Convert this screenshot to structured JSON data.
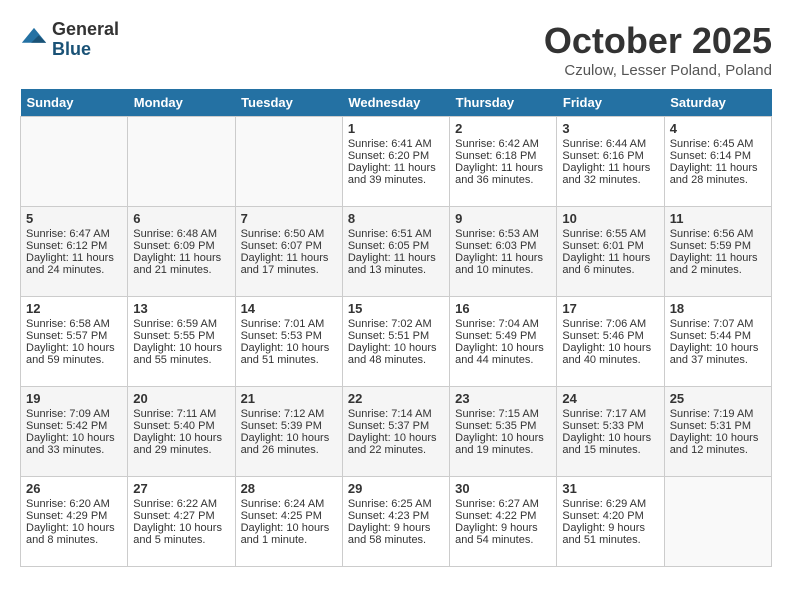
{
  "header": {
    "logo_general": "General",
    "logo_blue": "Blue",
    "month_title": "October 2025",
    "location": "Czulow, Lesser Poland, Poland"
  },
  "days_of_week": [
    "Sunday",
    "Monday",
    "Tuesday",
    "Wednesday",
    "Thursday",
    "Friday",
    "Saturday"
  ],
  "weeks": [
    [
      {
        "day": "",
        "content": ""
      },
      {
        "day": "",
        "content": ""
      },
      {
        "day": "",
        "content": ""
      },
      {
        "day": "1",
        "content": "Sunrise: 6:41 AM\nSunset: 6:20 PM\nDaylight: 11 hours\nand 39 minutes."
      },
      {
        "day": "2",
        "content": "Sunrise: 6:42 AM\nSunset: 6:18 PM\nDaylight: 11 hours\nand 36 minutes."
      },
      {
        "day": "3",
        "content": "Sunrise: 6:44 AM\nSunset: 6:16 PM\nDaylight: 11 hours\nand 32 minutes."
      },
      {
        "day": "4",
        "content": "Sunrise: 6:45 AM\nSunset: 6:14 PM\nDaylight: 11 hours\nand 28 minutes."
      }
    ],
    [
      {
        "day": "5",
        "content": "Sunrise: 6:47 AM\nSunset: 6:12 PM\nDaylight: 11 hours\nand 24 minutes."
      },
      {
        "day": "6",
        "content": "Sunrise: 6:48 AM\nSunset: 6:09 PM\nDaylight: 11 hours\nand 21 minutes."
      },
      {
        "day": "7",
        "content": "Sunrise: 6:50 AM\nSunset: 6:07 PM\nDaylight: 11 hours\nand 17 minutes."
      },
      {
        "day": "8",
        "content": "Sunrise: 6:51 AM\nSunset: 6:05 PM\nDaylight: 11 hours\nand 13 minutes."
      },
      {
        "day": "9",
        "content": "Sunrise: 6:53 AM\nSunset: 6:03 PM\nDaylight: 11 hours\nand 10 minutes."
      },
      {
        "day": "10",
        "content": "Sunrise: 6:55 AM\nSunset: 6:01 PM\nDaylight: 11 hours\nand 6 minutes."
      },
      {
        "day": "11",
        "content": "Sunrise: 6:56 AM\nSunset: 5:59 PM\nDaylight: 11 hours\nand 2 minutes."
      }
    ],
    [
      {
        "day": "12",
        "content": "Sunrise: 6:58 AM\nSunset: 5:57 PM\nDaylight: 10 hours\nand 59 minutes."
      },
      {
        "day": "13",
        "content": "Sunrise: 6:59 AM\nSunset: 5:55 PM\nDaylight: 10 hours\nand 55 minutes."
      },
      {
        "day": "14",
        "content": "Sunrise: 7:01 AM\nSunset: 5:53 PM\nDaylight: 10 hours\nand 51 minutes."
      },
      {
        "day": "15",
        "content": "Sunrise: 7:02 AM\nSunset: 5:51 PM\nDaylight: 10 hours\nand 48 minutes."
      },
      {
        "day": "16",
        "content": "Sunrise: 7:04 AM\nSunset: 5:49 PM\nDaylight: 10 hours\nand 44 minutes."
      },
      {
        "day": "17",
        "content": "Sunrise: 7:06 AM\nSunset: 5:46 PM\nDaylight: 10 hours\nand 40 minutes."
      },
      {
        "day": "18",
        "content": "Sunrise: 7:07 AM\nSunset: 5:44 PM\nDaylight: 10 hours\nand 37 minutes."
      }
    ],
    [
      {
        "day": "19",
        "content": "Sunrise: 7:09 AM\nSunset: 5:42 PM\nDaylight: 10 hours\nand 33 minutes."
      },
      {
        "day": "20",
        "content": "Sunrise: 7:11 AM\nSunset: 5:40 PM\nDaylight: 10 hours\nand 29 minutes."
      },
      {
        "day": "21",
        "content": "Sunrise: 7:12 AM\nSunset: 5:39 PM\nDaylight: 10 hours\nand 26 minutes."
      },
      {
        "day": "22",
        "content": "Sunrise: 7:14 AM\nSunset: 5:37 PM\nDaylight: 10 hours\nand 22 minutes."
      },
      {
        "day": "23",
        "content": "Sunrise: 7:15 AM\nSunset: 5:35 PM\nDaylight: 10 hours\nand 19 minutes."
      },
      {
        "day": "24",
        "content": "Sunrise: 7:17 AM\nSunset: 5:33 PM\nDaylight: 10 hours\nand 15 minutes."
      },
      {
        "day": "25",
        "content": "Sunrise: 7:19 AM\nSunset: 5:31 PM\nDaylight: 10 hours\nand 12 minutes."
      }
    ],
    [
      {
        "day": "26",
        "content": "Sunrise: 6:20 AM\nSunset: 4:29 PM\nDaylight: 10 hours\nand 8 minutes."
      },
      {
        "day": "27",
        "content": "Sunrise: 6:22 AM\nSunset: 4:27 PM\nDaylight: 10 hours\nand 5 minutes."
      },
      {
        "day": "28",
        "content": "Sunrise: 6:24 AM\nSunset: 4:25 PM\nDaylight: 10 hours\nand 1 minute."
      },
      {
        "day": "29",
        "content": "Sunrise: 6:25 AM\nSunset: 4:23 PM\nDaylight: 9 hours\nand 58 minutes."
      },
      {
        "day": "30",
        "content": "Sunrise: 6:27 AM\nSunset: 4:22 PM\nDaylight: 9 hours\nand 54 minutes."
      },
      {
        "day": "31",
        "content": "Sunrise: 6:29 AM\nSunset: 4:20 PM\nDaylight: 9 hours\nand 51 minutes."
      },
      {
        "day": "",
        "content": ""
      }
    ]
  ]
}
